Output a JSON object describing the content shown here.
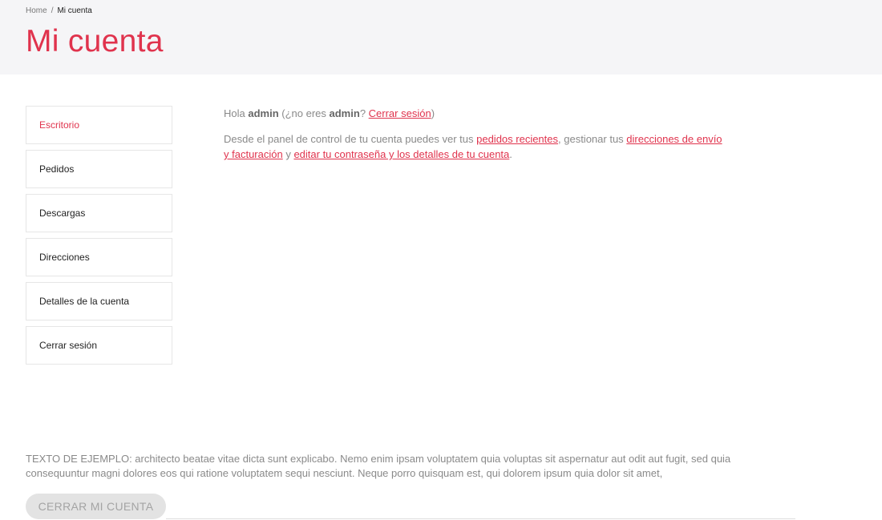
{
  "breadcrumb": {
    "home": "Home",
    "separator": "/",
    "current": "Mi cuenta"
  },
  "page_title": "Mi cuenta",
  "nav": {
    "items": [
      {
        "label": "Escritorio",
        "active": true
      },
      {
        "label": "Pedidos",
        "active": false
      },
      {
        "label": "Descargas",
        "active": false
      },
      {
        "label": "Direcciones",
        "active": false
      },
      {
        "label": "Detalles de la cuenta",
        "active": false
      },
      {
        "label": "Cerrar sesión",
        "active": false
      }
    ]
  },
  "greeting": {
    "hello": "Hola ",
    "username": "admin",
    "not_you_open": " (¿no eres ",
    "not_you_close": "? ",
    "logout_link": "Cerrar sesión",
    "paren_close": ")"
  },
  "dashboard": {
    "intro": "Desde el panel de control de tu cuenta puedes ver tus ",
    "orders_link": "pedidos recientes",
    "mid1": ", gestionar tus ",
    "addresses_link": "direcciones de envío y facturación",
    "mid2": " y ",
    "account_link": "editar tu contraseña y los detalles de tu cuenta",
    "end": "."
  },
  "footer": {
    "sample_text": "TEXTO DE EJEMPLO: architecto beatae vitae dicta sunt explicabo. Nemo enim ipsam voluptatem quia voluptas sit aspernatur aut odit aut fugit, sed quia consequuntur magni dolores eos qui ratione voluptatem sequi nesciunt. Neque porro quisquam est, qui dolorem ipsum quia dolor sit amet,",
    "close_account_label": "CERRAR MI CUENTA"
  },
  "colors": {
    "accent": "#e0334d",
    "header_bg": "#f5f5f7",
    "text_muted": "#8a8a8a",
    "button_bg": "#e3e3e3"
  }
}
